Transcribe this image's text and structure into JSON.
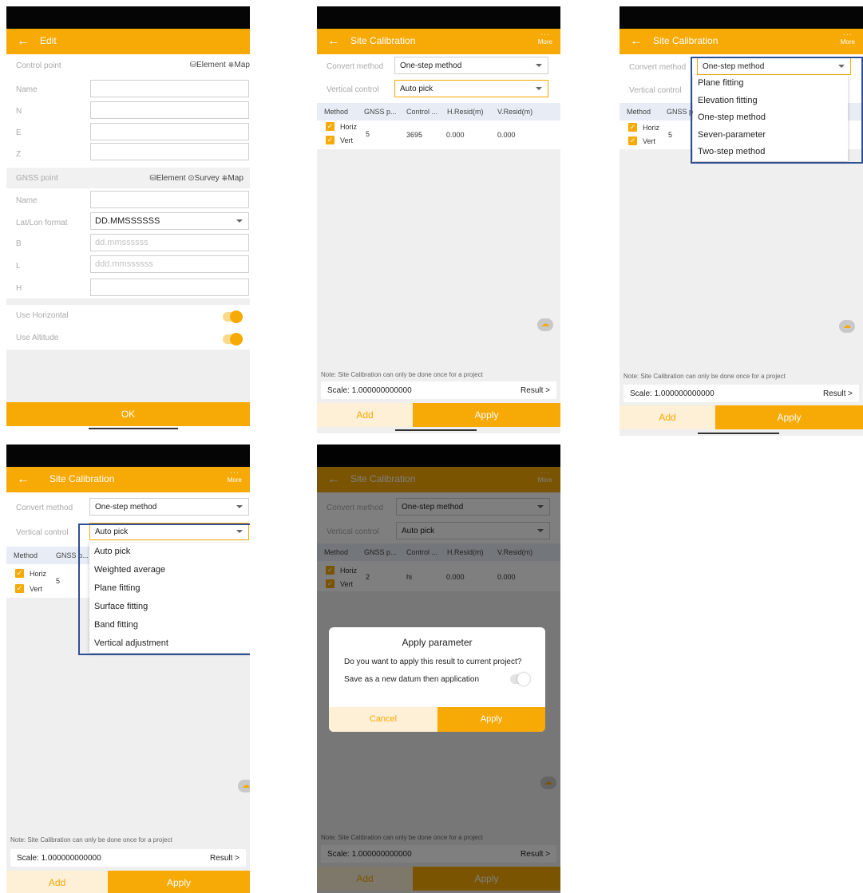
{
  "colors": {
    "accent": "#F7A905",
    "frame": "#2f4f94"
  },
  "edit": {
    "title": "Edit",
    "control_header": "Control point",
    "control_actions": "⛁Element ⎈Map",
    "control_fields": [
      {
        "label": "Name",
        "value": ""
      },
      {
        "label": "N",
        "value": ""
      },
      {
        "label": "E",
        "value": ""
      },
      {
        "label": "Z",
        "value": ""
      }
    ],
    "gnss_header": "GNSS point",
    "gnss_actions": "⛁Element ⊙Survey ⎈Map",
    "gnss_name_label": "Name",
    "latlon_label": "Lat/Lon format",
    "latlon_value": "DD.MMSSSSSS",
    "b_label": "B",
    "b_placeholder": "dd.mmssssss",
    "l_label": "L",
    "l_placeholder": "ddd.mmssssss",
    "h_label": "H",
    "use_horizontal": "Use Horizontal",
    "use_altitude": "Use Altitude",
    "ok": "OK"
  },
  "site": {
    "title": "Site Calibration",
    "more": "More",
    "convert_label": "Convert method",
    "convert_value": "One-step method",
    "vertical_label": "Vertical control",
    "vertical_value": "Auto pick",
    "table_headers": [
      "Method",
      "GNSS p...",
      "Control ...",
      "H.Resid(m)",
      "V.Resid(m)"
    ],
    "horiz": "Horiz",
    "vert": "Vert",
    "row1": {
      "gnss": "5",
      "control": "3695",
      "hresid": "0.000",
      "vresid": "0.000"
    },
    "row5": {
      "gnss": "2",
      "control": "hi",
      "hresid": "0.000",
      "vresid": "0.000"
    },
    "note": "Note: Site Calibration can only be done once for a project",
    "scale": "Scale: 1.000000000000",
    "result": "Result  >",
    "add": "Add",
    "apply": "Apply"
  },
  "convert_options": [
    "Plane fitting",
    "Elevation fitting",
    "One-step method",
    "Seven-parameter",
    "Two-step method"
  ],
  "vertical_options": [
    "Auto pick",
    "Weighted average",
    "Plane fitting",
    "Surface fitting",
    "Band fitting",
    "Vertical adjustment"
  ],
  "dialog": {
    "title": "Apply parameter",
    "message": "Do you want to apply this result to current project?",
    "save_label": "Save as a new datum then application",
    "cancel": "Cancel",
    "apply": "Apply"
  }
}
